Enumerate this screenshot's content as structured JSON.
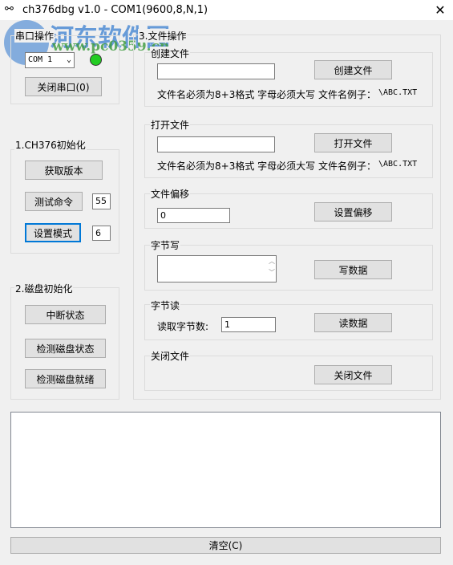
{
  "window": {
    "title": "ch376dbg v1.0 - COM1(9600,8,N,1)",
    "close": "✕"
  },
  "watermark": {
    "name": "河东软件园",
    "url": "www.pc0359.cn"
  },
  "serial": {
    "group": "串口操作",
    "port": "COM 1",
    "close_btn": "关闭串口(0)",
    "status_color": "#22cc22"
  },
  "init": {
    "group": "1.CH376初始化",
    "get_version": "获取版本",
    "test_cmd": "测试命令",
    "test_val": "55",
    "set_mode": "设置模式",
    "mode_val": "6"
  },
  "disk": {
    "group": "2.磁盘初始化",
    "int_status": "中断状态",
    "check_status": "检测磁盘状态",
    "check_ready": "检测磁盘就绪"
  },
  "file": {
    "group": "3.文件操作",
    "create": {
      "label": "创建文件",
      "value": "",
      "btn": "创建文件",
      "hint": "文件名必须为8+3格式 字母必须大写 文件名例子：",
      "example": "\\ABC.TXT"
    },
    "open": {
      "label": "打开文件",
      "value": "",
      "btn": "打开文件",
      "hint": "文件名必须为8+3格式 字母必须大写 文件名例子：",
      "example": "\\ABC.TXT"
    },
    "offset": {
      "label": "文件偏移",
      "value": "0",
      "btn": "设置偏移"
    },
    "write": {
      "label": "字节写",
      "value": "",
      "btn": "写数据"
    },
    "read": {
      "label": "字节读",
      "count_label": "读取字节数:",
      "value": "1",
      "btn": "读数据"
    },
    "close": {
      "label": "关闭文件",
      "btn": "关闭文件"
    }
  },
  "log": {
    "text": ""
  },
  "clear_btn": "清空(C)"
}
